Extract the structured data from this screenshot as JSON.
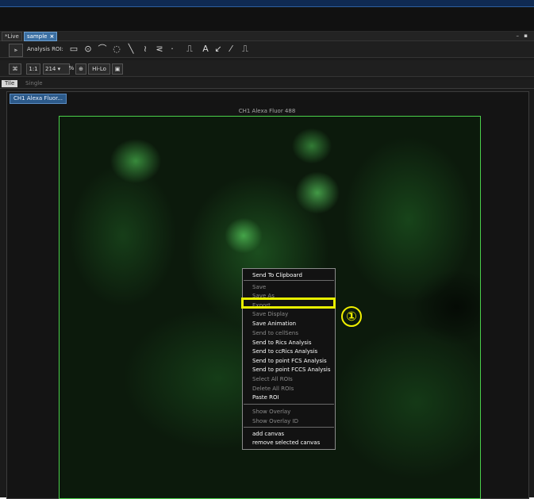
{
  "tabs": {
    "live": "*Live",
    "sample": "sample",
    "close_glyph": "×"
  },
  "window_controls": "– ▪",
  "toolbar1": {
    "toggle_glyph": "⫸",
    "roi_label": "Analysis ROI:",
    "tools": [
      "▭",
      "⊙",
      "⌒",
      "◌",
      "╲",
      "≀",
      "⋜",
      "·",
      "⎍",
      "A",
      "↙",
      "⁄",
      "⎍"
    ]
  },
  "toolbar2": {
    "fit_glyph": "⌘",
    "one_to_one": "1:1",
    "zoom_value": "214",
    "zoom_unit": "%",
    "zoom_glyph": "⊕",
    "lut": "Hi-Lo",
    "monitor_glyph": "▣"
  },
  "view_tabs": {
    "tile": "Tile",
    "single": "Single"
  },
  "channel_button": "CH1 Alexa Fluor...",
  "image_title": "CH1 Alexa Fluor 488",
  "context_menu": {
    "items": [
      {
        "label": "Send To Clipboard",
        "enabled": true
      },
      {
        "label": "Save",
        "enabled": false
      },
      {
        "label": "Save As",
        "enabled": false
      },
      {
        "label": "Export",
        "enabled": false
      },
      {
        "label": "Save Display",
        "enabled": false
      },
      {
        "label": "Save Animation",
        "enabled": true
      },
      {
        "label": "Send to cellSens",
        "enabled": false
      },
      {
        "label": "Send to Rics Analysis",
        "enabled": true
      },
      {
        "label": "Send to ccRics Analysis",
        "enabled": true
      },
      {
        "label": "Send to point FCS Analysis",
        "enabled": true
      },
      {
        "label": "Send to point FCCS Analysis",
        "enabled": true
      },
      {
        "label": "Select All ROIs",
        "enabled": false
      },
      {
        "label": "Delete All ROIs",
        "enabled": false
      },
      {
        "label": "Paste ROI",
        "enabled": true
      },
      {
        "label": "Show Overlay",
        "enabled": false
      },
      {
        "label": "Show Overlay ID",
        "enabled": false
      },
      {
        "label": "add canvas",
        "enabled": true
      },
      {
        "label": "remove selected canvas",
        "enabled": true
      }
    ]
  },
  "callout": {
    "number": "①"
  },
  "colors": {
    "highlight": "#e8f000",
    "image_border": "#4bd04b",
    "tab_active": "#3a6fa3"
  }
}
